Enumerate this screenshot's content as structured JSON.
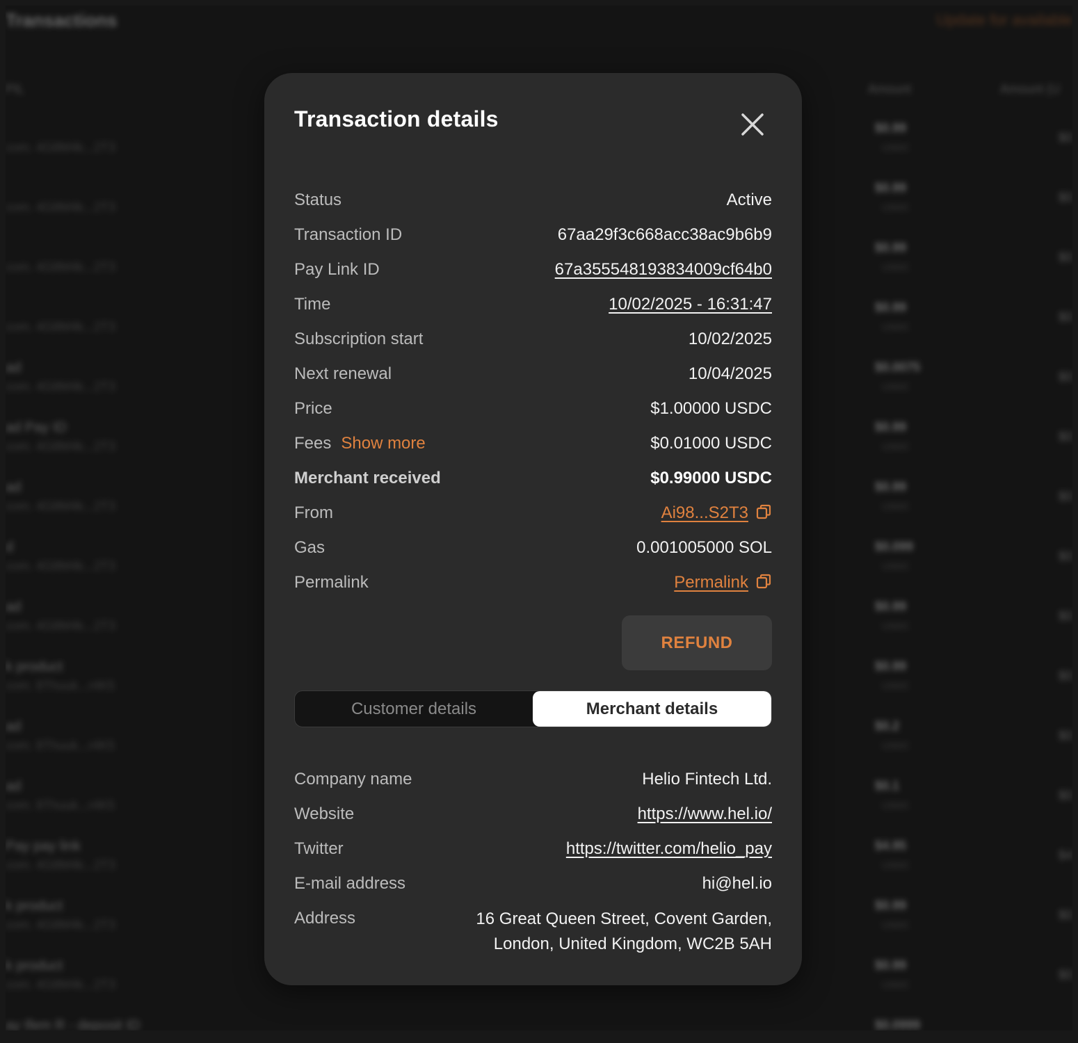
{
  "background": {
    "title": "Transactions",
    "link": "Update for available",
    "headers": {
      "col1": "PIL",
      "amount": "Amount",
      "amount_usd": "Amount (U"
    },
    "rows": [
      {
        "name": "",
        "sub": "com. 4G8M4k...2T3",
        "amount": "$0.99",
        "currency": "USDC",
        "amount2": "$0"
      },
      {
        "name": "",
        "sub": "com. 4G8M4k...2T3",
        "amount": "$0.99",
        "currency": "USDC",
        "amount2": "$0"
      },
      {
        "name": "",
        "sub": "com. 4G8M4k...2T3",
        "amount": "$0.99",
        "currency": "USDC",
        "amount2": "$0"
      },
      {
        "name": "",
        "sub": "com. 4G8M4k...2T3",
        "amount": "$0.99",
        "currency": "USDC",
        "amount2": "$0"
      },
      {
        "name": "ad",
        "sub": "com. 4G8M4k...2T3",
        "amount": "$0.0075",
        "currency": "USDC",
        "amount2": "$0"
      },
      {
        "name": "ad Pay ID",
        "sub": "com. 4G8M4k...2T3",
        "amount": "$0.99",
        "currency": "USDC",
        "amount2": "$0"
      },
      {
        "name": "ad",
        "sub": "com. 4G8M4k...2T3",
        "amount": "$0.99",
        "currency": "USDC",
        "amount2": "$0"
      },
      {
        "name": "d",
        "sub": "com. 4G8M4k...2T3",
        "amount": "$0.099",
        "currency": "USDC",
        "amount2": "$0"
      },
      {
        "name": "ad",
        "sub": "com. 4G8M4k...2T3",
        "amount": "$0.99",
        "currency": "USDC",
        "amount2": "$0"
      },
      {
        "name": "k product",
        "sub": "com. 8Thuuk...r4K5",
        "amount": "$0.99",
        "currency": "USDC",
        "amount2": "$0"
      },
      {
        "name": "ad",
        "sub": "com. 8Thuuk...r4K5",
        "amount": "$0.2",
        "currency": "USDC",
        "amount2": "$0"
      },
      {
        "name": "ad",
        "sub": "com. 8Thuuk...r4K5",
        "amount": "$0.1",
        "currency": "USDC",
        "amount2": "$0"
      },
      {
        "name": "Pay pay link",
        "sub": "com. 4G8M4k...2T3",
        "amount": "$4.95",
        "currency": "USDC",
        "amount2": "$4"
      },
      {
        "name": "k product",
        "sub": "com. 4G8M4k...2T3",
        "amount": "$0.99",
        "currency": "USDC",
        "amount2": "$0"
      },
      {
        "name": "k product",
        "sub": "com. 4G8M4k...2T3",
        "amount": "$0.99",
        "currency": "USDC",
        "amount2": "$0"
      },
      {
        "name": "ay Ifem R - deposit ID",
        "sub": "",
        "amount": "$0.0999",
        "currency": "",
        "amount2": ""
      }
    ]
  },
  "modal": {
    "title": "Transaction details",
    "close_icon": "close-icon",
    "details": {
      "status": {
        "label": "Status",
        "value": "Active"
      },
      "transaction_id": {
        "label": "Transaction ID",
        "value": "67aa29f3c668acc38ac9b6b9"
      },
      "pay_link_id": {
        "label": "Pay Link ID",
        "value": "67a355548193834009cf64b0"
      },
      "time": {
        "label": "Time",
        "value": "10/02/2025 - 16:31:47"
      },
      "subscription_start": {
        "label": "Subscription start",
        "value": "10/02/2025"
      },
      "next_renewal": {
        "label": "Next renewal",
        "value": "10/04/2025"
      },
      "price": {
        "label": "Price",
        "value": "$1.00000 USDC"
      },
      "fees": {
        "label": "Fees",
        "show_more": "Show more",
        "value": "$0.01000 USDC"
      },
      "merchant_received": {
        "label": "Merchant received",
        "value": "$0.99000 USDC"
      },
      "from": {
        "label": "From",
        "value": "Ai98...S2T3"
      },
      "gas": {
        "label": "Gas",
        "value": "0.001005000 SOL"
      },
      "permalink": {
        "label": "Permalink",
        "value": "Permalink"
      }
    },
    "refund_label": "REFUND",
    "tabs": {
      "customer": "Customer details",
      "merchant": "Merchant details",
      "active": "merchant"
    },
    "merchant": {
      "company_name": {
        "label": "Company name",
        "value": "Helio Fintech Ltd."
      },
      "website": {
        "label": "Website",
        "value": "https://www.hel.io/"
      },
      "twitter": {
        "label": "Twitter",
        "value": "https://twitter.com/helio_pay"
      },
      "email": {
        "label": "E-mail address",
        "value": "hi@hel.io"
      },
      "address": {
        "label": "Address",
        "line1": "16 Great Queen Street, Covent Garden,",
        "line2": "London, United Kingdom, WC2B 5AH"
      }
    },
    "colors": {
      "accent": "#e0823f",
      "modal_bg": "#2b2b2b",
      "page_bg": "#181818"
    }
  }
}
